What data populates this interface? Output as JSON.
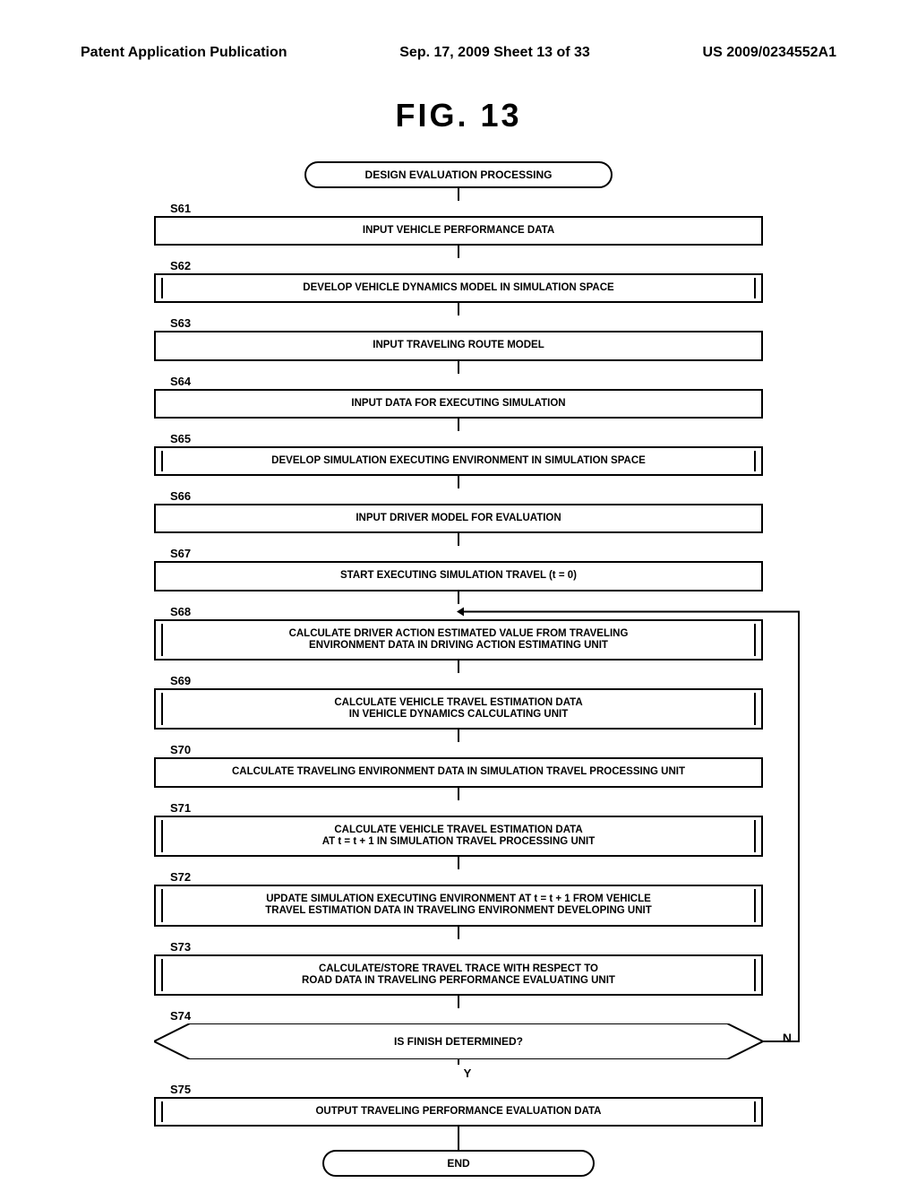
{
  "header": {
    "left": "Patent Application Publication",
    "center": "Sep. 17, 2009  Sheet 13 of 33",
    "right": "US 2009/0234552A1"
  },
  "figure_title": "FIG. 13",
  "terminators": {
    "start": "DESIGN EVALUATION PROCESSING",
    "end": "END"
  },
  "decision": {
    "label": "S74",
    "text": "IS FINISH DETERMINED?",
    "yes": "Y",
    "no": "N"
  },
  "steps": [
    {
      "id": "S61",
      "text": "INPUT VEHICLE PERFORMANCE DATA",
      "predefined": false
    },
    {
      "id": "S62",
      "text": "DEVELOP VEHICLE DYNAMICS MODEL IN SIMULATION SPACE",
      "predefined": true
    },
    {
      "id": "S63",
      "text": "INPUT TRAVELING ROUTE MODEL",
      "predefined": false
    },
    {
      "id": "S64",
      "text": "INPUT DATA FOR EXECUTING SIMULATION",
      "predefined": false
    },
    {
      "id": "S65",
      "text": "DEVELOP SIMULATION EXECUTING ENVIRONMENT IN SIMULATION SPACE",
      "predefined": true
    },
    {
      "id": "S66",
      "text": "INPUT DRIVER MODEL FOR EVALUATION",
      "predefined": false
    },
    {
      "id": "S67",
      "text": "START EXECUTING SIMULATION TRAVEL (t = 0)",
      "predefined": false
    },
    {
      "id": "S68",
      "text": "CALCULATE DRIVER ACTION ESTIMATED VALUE FROM TRAVELING\nENVIRONMENT DATA IN DRIVING ACTION ESTIMATING UNIT",
      "predefined": true
    },
    {
      "id": "S69",
      "text": "CALCULATE VEHICLE TRAVEL ESTIMATION DATA\nIN VEHICLE DYNAMICS CALCULATING UNIT",
      "predefined": true
    },
    {
      "id": "S70",
      "text": "CALCULATE TRAVELING ENVIRONMENT DATA IN SIMULATION TRAVEL PROCESSING UNIT",
      "predefined": false
    },
    {
      "id": "S71",
      "text": "CALCULATE VEHICLE TRAVEL ESTIMATION DATA\nAT t = t + 1 IN SIMULATION TRAVEL PROCESSING UNIT",
      "predefined": true
    },
    {
      "id": "S72",
      "text": "UPDATE SIMULATION EXECUTING ENVIRONMENT AT t = t + 1 FROM VEHICLE\nTRAVEL ESTIMATION DATA IN TRAVELING ENVIRONMENT DEVELOPING UNIT",
      "predefined": true
    },
    {
      "id": "S73",
      "text": "CALCULATE/STORE TRAVEL TRACE WITH RESPECT TO\nROAD DATA IN TRAVELING PERFORMANCE EVALUATING UNIT",
      "predefined": true
    }
  ],
  "final_step": {
    "id": "S75",
    "text": "OUTPUT TRAVELING PERFORMANCE EVALUATION DATA",
    "predefined": true
  }
}
